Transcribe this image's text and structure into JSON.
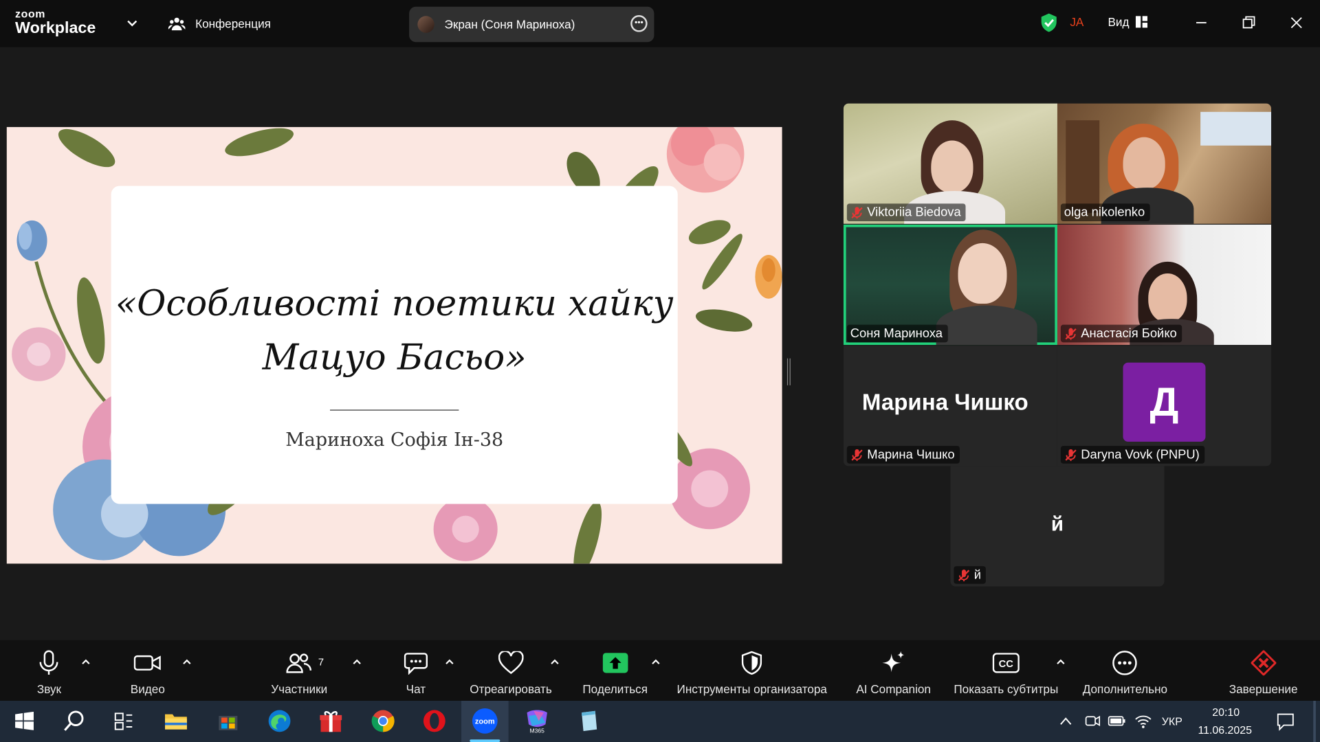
{
  "window": {
    "logo_line1": "zoom",
    "logo_line2": "Workplace",
    "meeting_label": "Конференция",
    "screen_share_label": "Экран (Соня Мариноха)",
    "user_initials": "JA",
    "view_label": "Вид"
  },
  "slide": {
    "title_line1": "«Особливості поетики хайку",
    "title_line2": "Мацуо Басьо»",
    "author": "Мариноха Софія Ін-38"
  },
  "participants": [
    {
      "name": "Viktoriia Biedova",
      "muted": true
    },
    {
      "name": "olga nikolenko",
      "muted": false
    },
    {
      "name": "Соня Мариноха",
      "muted": false,
      "speaking": true
    },
    {
      "name": "Анастасія Бойко",
      "muted": true
    },
    {
      "name": "Марина Чишко",
      "muted": true,
      "display_name": "Марина Чишко"
    },
    {
      "name": "Daryna Vovk (PNPU)",
      "muted": true,
      "avatar_letter": "Д"
    },
    {
      "name": "й",
      "muted": true,
      "display_name": "й"
    }
  ],
  "toolbar": {
    "audio": "Звук",
    "video": "Видео",
    "participants": "Участники",
    "participants_count": "7",
    "chat": "Чат",
    "react": "Отреагировать",
    "share": "Поделиться",
    "host_tools": "Инструменты организатора",
    "ai_companion": "AI Companion",
    "captions": "Показать субтитры",
    "more": "Дополнительно",
    "end": "Завершение"
  },
  "colors": {
    "accent_green": "#22d07a",
    "share_green": "#22c55e",
    "end_red": "#e02828",
    "avatar_purple": "#7b1fa2",
    "initials_orange": "#e8401c"
  },
  "taskbar": {
    "language": "УКР",
    "time": "20:10",
    "date": "11.06.2025",
    "m365_label": "M365",
    "zoom_label": "zoom"
  }
}
